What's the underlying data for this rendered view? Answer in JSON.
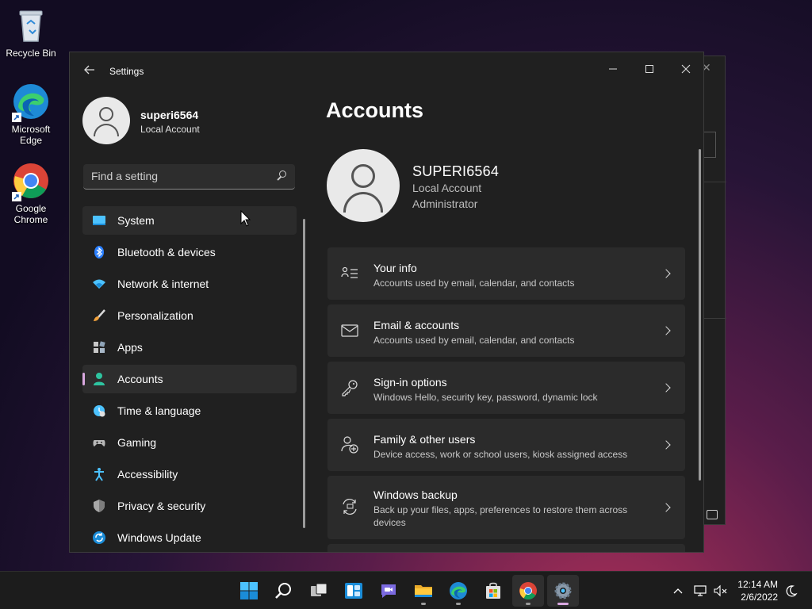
{
  "desktop": {
    "icons": [
      {
        "label": "Recycle Bin",
        "icon": "recycle-bin-icon"
      },
      {
        "label": "Microsoft Edge",
        "icon": "edge-icon"
      },
      {
        "label": "Google Chrome",
        "icon": "chrome-icon"
      }
    ]
  },
  "window": {
    "title": "Settings",
    "back_icon": "back-arrow-icon",
    "controls": [
      "minimize",
      "maximize",
      "close"
    ]
  },
  "sidebar": {
    "profile": {
      "name": "superi6564",
      "type": "Local Account"
    },
    "search": {
      "placeholder": "Find a setting",
      "value": ""
    },
    "items": [
      {
        "label": "System",
        "icon": "system-icon",
        "state": "hover"
      },
      {
        "label": "Bluetooth & devices",
        "icon": "bluetooth-icon",
        "state": ""
      },
      {
        "label": "Network & internet",
        "icon": "network-icon",
        "state": ""
      },
      {
        "label": "Personalization",
        "icon": "brush-icon",
        "state": ""
      },
      {
        "label": "Apps",
        "icon": "apps-icon",
        "state": ""
      },
      {
        "label": "Accounts",
        "icon": "accounts-icon",
        "state": "active"
      },
      {
        "label": "Time & language",
        "icon": "time-language-icon",
        "state": ""
      },
      {
        "label": "Gaming",
        "icon": "gaming-icon",
        "state": ""
      },
      {
        "label": "Accessibility",
        "icon": "accessibility-icon",
        "state": ""
      },
      {
        "label": "Privacy & security",
        "icon": "shield-icon",
        "state": ""
      },
      {
        "label": "Windows Update",
        "icon": "windows-update-icon",
        "state": ""
      }
    ]
  },
  "main": {
    "title": "Accounts",
    "account": {
      "name": "SUPERI6564",
      "type": "Local Account",
      "role": "Administrator"
    },
    "cards": [
      {
        "title": "Your info",
        "subtitle": "Accounts used by email, calendar, and contacts",
        "icon": "your-info-icon"
      },
      {
        "title": "Email & accounts",
        "subtitle": "Accounts used by email, calendar, and contacts",
        "icon": "mail-icon"
      },
      {
        "title": "Sign-in options",
        "subtitle": "Windows Hello, security key, password, dynamic lock",
        "icon": "key-icon"
      },
      {
        "title": "Family & other users",
        "subtitle": "Device access, work or school users, kiosk assigned access",
        "icon": "family-icon"
      },
      {
        "title": "Windows backup",
        "subtitle": "Back up your files, apps, preferences to restore them across devices",
        "icon": "backup-icon"
      }
    ]
  },
  "taskbar": {
    "apps": [
      "start",
      "search",
      "task-view",
      "widgets",
      "chat",
      "file-explorer",
      "edge",
      "store",
      "chrome",
      "settings"
    ],
    "time": "12:14 AM",
    "date": "2/6/2022"
  },
  "colors": {
    "accent": "#d9a8e0",
    "window_bg": "#202020",
    "card_bg": "#2b2b2b"
  }
}
